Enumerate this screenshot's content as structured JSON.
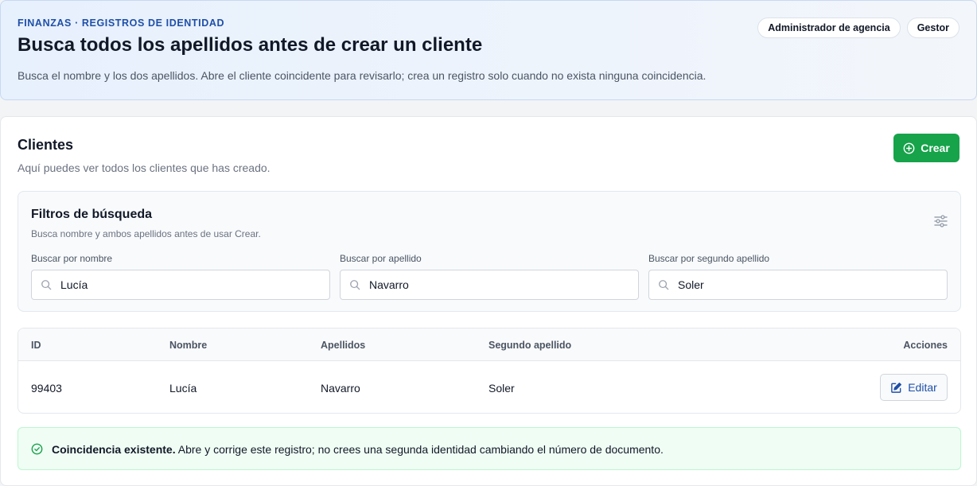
{
  "header": {
    "eyebrow": "FINANZAS · REGISTROS DE IDENTIDAD",
    "title": "Busca todos los apellidos antes de crear un cliente",
    "description": "Busca el nombre y los dos apellidos. Abre el cliente coincidente para revisarlo; crea un registro solo cuando no exista ninguna coincidencia.",
    "roles": [
      "Administrador de agencia",
      "Gestor"
    ]
  },
  "clients": {
    "title": "Clientes",
    "subtitle": "Aquí puedes ver todos los clientes que has creado.",
    "create_label": "Crear"
  },
  "filters": {
    "title": "Filtros de búsqueda",
    "hint": "Busca nombre y ambos apellidos antes de usar Crear.",
    "fields": [
      {
        "label": "Buscar por nombre",
        "value": "Lucía"
      },
      {
        "label": "Buscar por apellido",
        "value": "Navarro"
      },
      {
        "label": "Buscar por segundo apellido",
        "value": "Soler"
      }
    ]
  },
  "table": {
    "columns": [
      "ID",
      "Nombre",
      "Apellidos",
      "Segundo apellido",
      "Acciones"
    ],
    "rows": [
      {
        "id": "99403",
        "nombre": "Lucía",
        "apellidos": "Navarro",
        "segundo": "Soler",
        "action": "Editar"
      }
    ]
  },
  "alert": {
    "strong": "Coincidencia existente.",
    "text": " Abre y corrige este registro; no crees una segunda identidad cambiando el número de documento."
  },
  "colors": {
    "accent": "#1e4fa8",
    "success": "#16a34a"
  }
}
